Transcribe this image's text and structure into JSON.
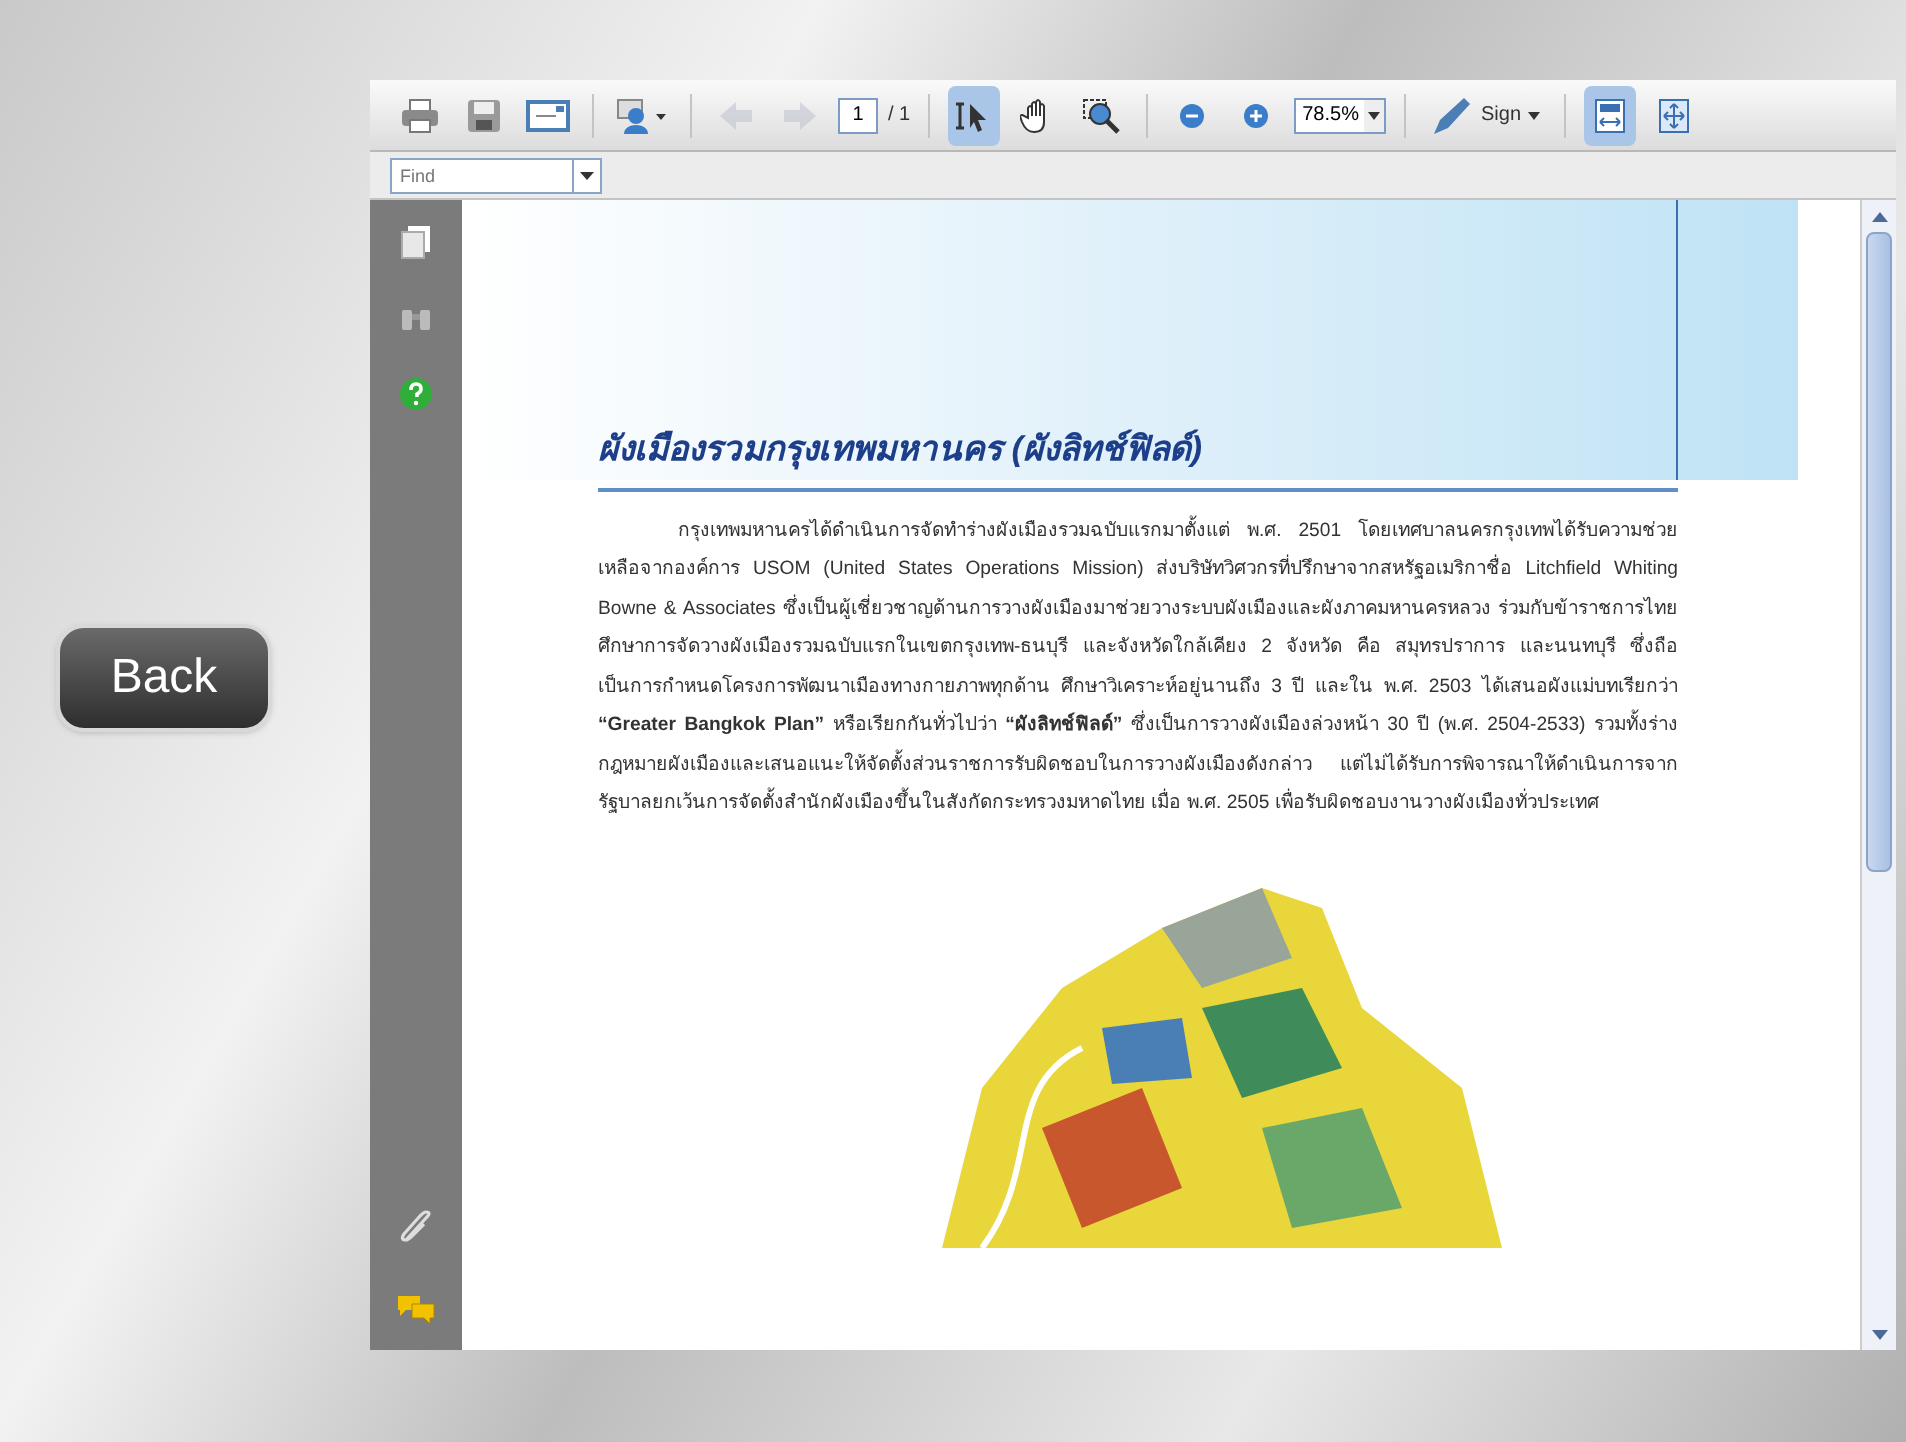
{
  "back_button": {
    "label": "Back"
  },
  "toolbar": {
    "tools": [
      {
        "kind": "print",
        "selected": false,
        "disabled": false
      },
      {
        "kind": "save",
        "selected": false,
        "disabled": false
      },
      {
        "kind": "email",
        "selected": false,
        "disabled": false
      },
      {
        "kind": "share",
        "selected": false,
        "disabled": false
      },
      {
        "kind": "prev",
        "selected": false,
        "disabled": true
      },
      {
        "kind": "next",
        "selected": false,
        "disabled": true
      },
      {
        "kind": "page",
        "selected": false,
        "disabled": false
      },
      {
        "kind": "select",
        "selected": true,
        "disabled": false
      },
      {
        "kind": "hand",
        "selected": false,
        "disabled": false
      },
      {
        "kind": "marquee",
        "selected": false,
        "disabled": false
      },
      {
        "kind": "zoomout",
        "selected": false,
        "disabled": false
      },
      {
        "kind": "zoomin",
        "selected": false,
        "disabled": false
      },
      {
        "kind": "zoom",
        "selected": false,
        "disabled": false
      },
      {
        "kind": "sign",
        "selected": false,
        "disabled": false
      },
      {
        "kind": "fitwidth",
        "selected": true,
        "disabled": false
      },
      {
        "kind": "fullscreen",
        "selected": false,
        "disabled": false
      }
    ],
    "page_field": "1",
    "page_total": "/ 1",
    "zoom_field": "78.5%",
    "sign_label": "Sign"
  },
  "find_field": {
    "placeholder": "Find"
  },
  "sidebar": {
    "top": [
      {
        "kind": "pages"
      },
      {
        "kind": "binoculars"
      },
      {
        "kind": "help"
      }
    ],
    "bottom": [
      {
        "kind": "attachment"
      },
      {
        "kind": "comments"
      }
    ]
  },
  "document": {
    "title": "ผังเมืองรวมกรุงเทพมหานคร (ผังลิทช์ฟิลด์)",
    "paragraph": "กรุงเทพมหานครได้ดำเนินการจัดทำร่างผังเมืองรวมฉบับแรกมาตั้งแต่ พ.ศ. 2501 โดยเทศบาลนครกรุงเทพได้รับความช่วยเหลือจากองค์การ USOM (United States Operations Mission) ส่งบริษัทวิศวกรที่ปรึกษาจากสหรัฐอเมริกาชื่อ Litchfield Whiting Bowne & Associates ซึ่งเป็นผู้เชี่ยวชาญด้านการวางผังเมืองมาช่วยวางระบบผังเมืองและผังภาคมหานครหลวง ร่วมกับข้าราชการไทยศึกษาการจัดวางผังเมืองรวมฉบับแรกในเขตกรุงเทพ-ธนบุรี และจังหวัดใกล้เคียง 2 จังหวัด คือ สมุทรปราการ และนนทบุรี ซึ่งถือเป็นการกำหนดโครงการพัฒนาเมืองทางกายภาพทุกด้าน ศึกษาวิเคราะห์อยู่นานถึง 3 ปี และใน พ.ศ. 2503 ได้เสนอผังแม่บทเรียกว่า **“Greater Bangkok Plan”** หรือเรียกกันทั่วไปว่า **“ผังลิทช์ฟิลด์”** ซึ่งเป็นการวางผังเมืองล่วงหน้า 30 ปี (พ.ศ. 2504-2533) รวมทั้งร่างกฎหมายผังเมืองและเสนอแนะให้จัดตั้งส่วนราชการรับผิดชอบในการวางผังเมืองดังกล่าว แต่ไม่ได้รับการพิจารณาให้ดำเนินการจากรัฐบาลยกเว้นการจัดตั้งสำนักผังเมืองขึ้นในสังกัดกระทรวงมหาดไทย เมื่อ พ.ศ. 2505 เพื่อรับผิดชอบงานวางผังเมืองทั่วประเทศ"
  }
}
